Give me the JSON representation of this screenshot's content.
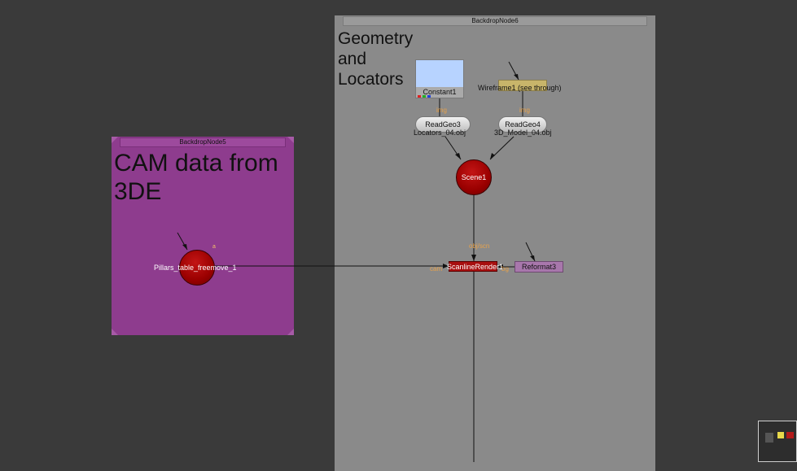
{
  "backdrop6": {
    "title": "BackdropNode6",
    "label": "Geometry\nand\nLocators"
  },
  "backdrop5": {
    "title": "BackdropNode5",
    "label": "CAM data from\n3DE"
  },
  "nodes": {
    "constant1": "Constant1",
    "wireframe1": "Wireframe1 (see through)",
    "readgeo3": "ReadGeo3",
    "readgeo3_file": "Locators_04.obj",
    "readgeo4": "ReadGeo4",
    "readgeo4_file": "3D_Model_04.obj",
    "scene1": "Scene1",
    "camera": "Pillars_table_freemove_1",
    "scanline": "ScanlineRender1",
    "reformat": "Reformat3"
  },
  "ports": {
    "img_a": "img",
    "img_b": "img",
    "objscn": "obj/scn",
    "cam": "cam",
    "bg": "bg",
    "camera_marker": "a"
  },
  "colors": {
    "canvas": "#3a3a3a",
    "backdrop6": "#8a8a8a",
    "backdrop5": "#8e3c8e",
    "node_red": "#a80f0f",
    "port_label": "#e7a24b"
  }
}
